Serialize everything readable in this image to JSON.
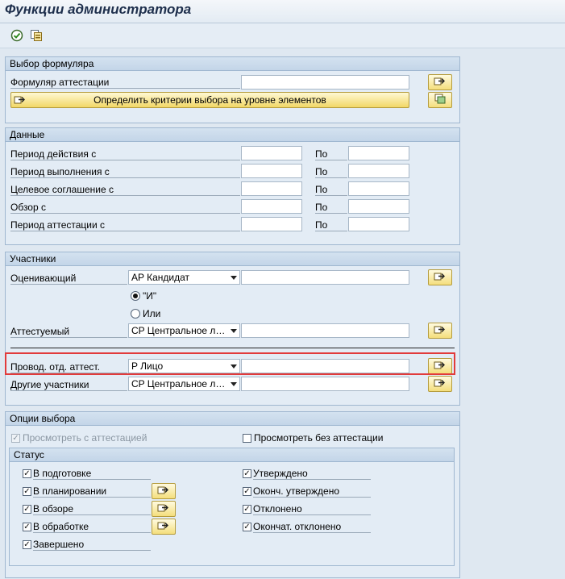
{
  "title": "Функции администратора",
  "toolbar": {
    "icons": [
      "execute-icon",
      "variant-icon"
    ]
  },
  "group_form": {
    "title": "Выбор формуляра",
    "form_label": "Формуляр аттестации",
    "form_value": "",
    "criteria_button": "Определить критерии выбора на уровне элементов"
  },
  "group_data": {
    "title": "Данные",
    "to_label": "По",
    "rows": [
      {
        "label": "Период действия с"
      },
      {
        "label": "Период выполнения с"
      },
      {
        "label": "Целевое соглашение с"
      },
      {
        "label": "Обзор с"
      },
      {
        "label": "Период аттестации с"
      }
    ]
  },
  "group_participants": {
    "title": "Участники",
    "appraiser_label": "Оценивающий",
    "appraiser_type": "AP Кандидат",
    "and_label": "\"И\"",
    "or_label": "Или",
    "logic_selected": "and",
    "appraisee_label": "Аттестуемый",
    "appraisee_type": "CP Центральное ли...",
    "conductor_label": "Провод. отд. аттест.",
    "conductor_type": "P Лицо",
    "others_label": "Другие участники",
    "others_type": "CP Центральное ли..."
  },
  "group_options": {
    "title": "Опции выбора",
    "with_appraisal": "Просмотреть с аттестацией",
    "with_appraisal_checked": true,
    "without_appraisal": "Просмотреть без аттестации",
    "without_appraisal_checked": false
  },
  "status": {
    "title": "Статус",
    "left": [
      {
        "label": "В подготовке",
        "checked": true
      },
      {
        "label": "В планировании",
        "checked": true
      },
      {
        "label": "В обзоре",
        "checked": true
      },
      {
        "label": "В обработке",
        "checked": true
      },
      {
        "label": "Завершено",
        "checked": true
      }
    ],
    "right": [
      {
        "label": "Утверждено",
        "checked": true
      },
      {
        "label": "Оконч. утверждено",
        "checked": true
      },
      {
        "label": "Отклонено",
        "checked": true
      },
      {
        "label": "Окончат. отклонено",
        "checked": true
      }
    ]
  },
  "colors": {
    "accent": "#e23b3b",
    "button": "#f2d766",
    "background": "#dfe8f1"
  }
}
